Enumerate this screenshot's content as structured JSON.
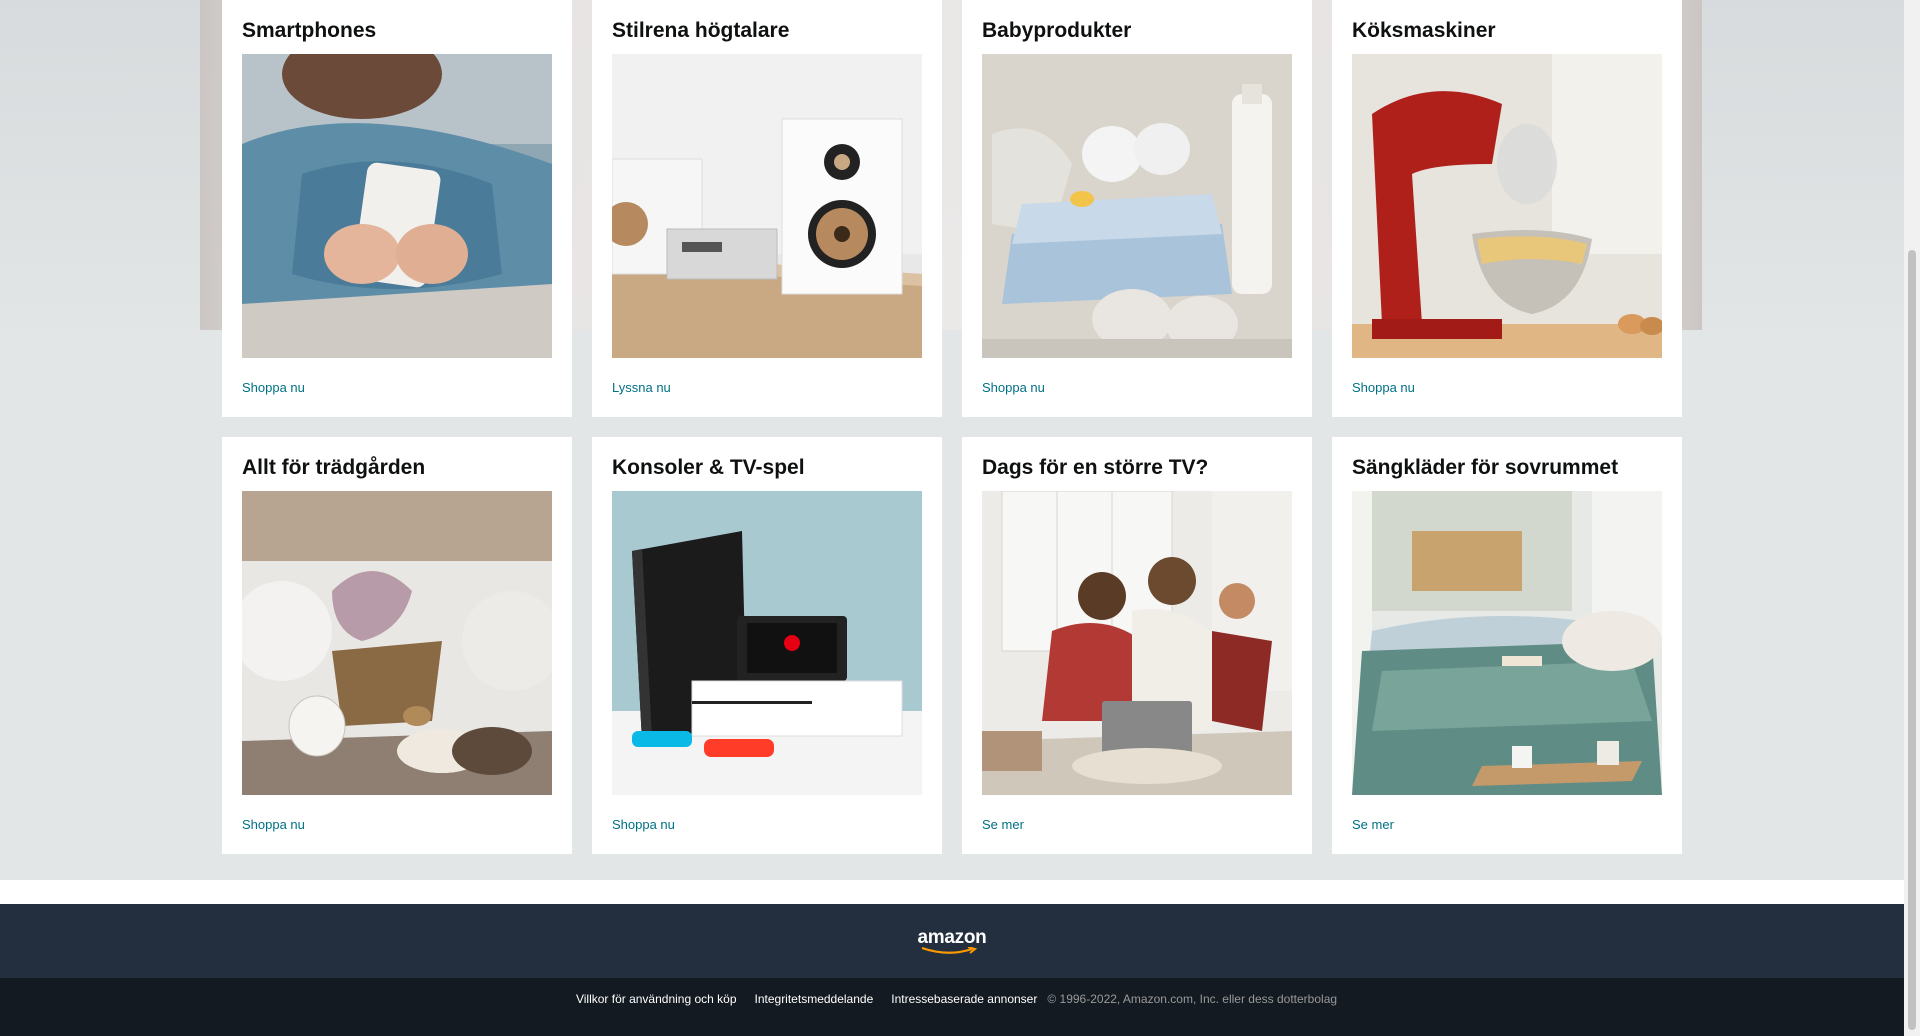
{
  "cards": [
    {
      "title": "Smartphones",
      "link": "Shoppa nu",
      "image": "woman-holding-phone-image"
    },
    {
      "title": "Stilrena högtalare",
      "link": "Lyssna nu",
      "image": "white-speakers-image"
    },
    {
      "title": "Babyprodukter",
      "link": "Shoppa nu",
      "image": "baby-clothes-image"
    },
    {
      "title": "Köksmaskiner",
      "link": "Shoppa nu",
      "image": "red-stand-mixer-image"
    },
    {
      "title": "Allt för trädgården",
      "link": "Shoppa nu",
      "image": "heather-basket-image"
    },
    {
      "title": "Konsoler & TV-spel",
      "link": "Shoppa nu",
      "image": "game-consoles-image"
    },
    {
      "title": "Dags för en större TV?",
      "link": "Se mer",
      "image": "family-laptop-image"
    },
    {
      "title": "Sängkläder för sovrummet",
      "link": "Se mer",
      "image": "bedroom-image"
    }
  ],
  "footer": {
    "logo": "amazon",
    "links": [
      "Villkor för användning och köp",
      "Integritetsmeddelande",
      "Intressebaserade annonser"
    ],
    "copyright": "© 1996-2022, Amazon.com, Inc. eller dess dotterbolag"
  },
  "colors": {
    "link": "#007185",
    "footer_top": "#232f3e",
    "footer_bottom": "#131a22",
    "logo_smile": "#ff9900"
  }
}
